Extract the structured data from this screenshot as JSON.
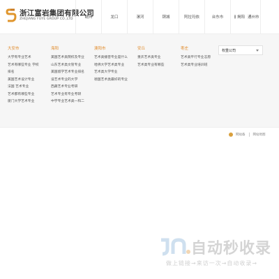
{
  "brand": {
    "name_cn": "浙江富岩集团有限公司",
    "name_en": "ZHEJIANG FUYE GROUP CO.,LTD"
  },
  "nav": {
    "items": [
      {
        "label": "赣州"
      },
      {
        "label": "龙口"
      },
      {
        "label": "漯河"
      },
      {
        "label": "铜城"
      },
      {
        "label": "阿拉玛依"
      },
      {
        "label": "台东市"
      }
    ],
    "location": {
      "primary": "揭阳",
      "secondary": "通州市"
    }
  },
  "panel": {
    "columns": [
      {
        "title": "大安市",
        "items": [
          "大学有专业艺术",
          "艺术有哪些专业 学校",
          "排名",
          "美国艺术设计专业",
          "法国 艺术专业",
          "艺术都有哪些专业",
          "厦门大学艺术专业"
        ]
      },
      {
        "title": "海阳",
        "items": [
          "美国艺术类院校及专业",
          "山东艺术类文管专业",
          "美国留学艺术专业排名",
          "设艺术专业的大学",
          "西藏艺术专业考研",
          "艺术专业有专业考研",
          "中学专业艺术类一和二"
        ]
      },
      {
        "title": "澳阳市",
        "items": [
          "艺术类播音专业是什么",
          "哈佛大学艺术类专业",
          "艺术类大学专业",
          "德国艺术类最好的专业"
        ]
      },
      {
        "title": "安丘",
        "items": [
          "重庆艺术类专业",
          "艺术类专业有哪些"
        ]
      },
      {
        "title": "枣庄",
        "items": [
          "艺术类平行专业志愿",
          "艺术类专业培训班"
        ]
      }
    ]
  },
  "select": {
    "value": "权重公司"
  },
  "footer": {
    "record_link": "网站备",
    "sitemap_link": "网站地图"
  },
  "watermark": {
    "title": "自动秒收录",
    "subtitle": "做上链接→来访一次→自动收录→"
  },
  "colors": {
    "accent": "#e08a2a",
    "panel_bg": "#f6f6f6"
  }
}
